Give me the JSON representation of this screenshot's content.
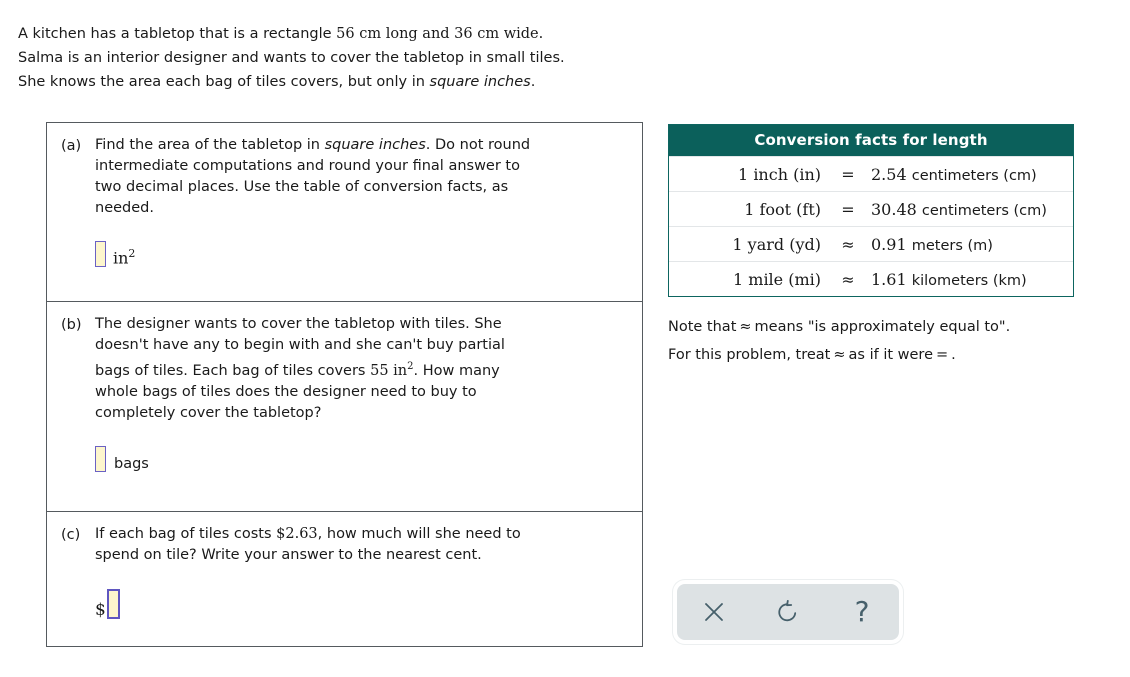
{
  "intro": {
    "line1_a": "A kitchen has a tabletop that is a rectangle ",
    "line1_num1": "56",
    "line1_b": " cm long and ",
    "line1_num2": "36",
    "line1_c": " cm wide.",
    "line2": "Salma is an interior designer and wants to cover the tabletop in small tiles.",
    "line3_a": "She knows the area each bag of tiles covers, but only in ",
    "line3_em": "square inches",
    "line3_b": "."
  },
  "parts": {
    "a": {
      "label": "(a)",
      "text_l1_a": "Find the area of the tabletop in ",
      "text_l1_em": "square inches",
      "text_l1_b": ". Do not round",
      "text_l2": "intermediate computations and round your final answer to",
      "text_l3": "two decimal places. Use the table of conversion facts, as",
      "text_l4": "needed.",
      "answer_value": "",
      "unit": "in",
      "unit_exponent": "2"
    },
    "b": {
      "label": "(b)",
      "text_l1": "The designer wants to cover the tabletop with tiles. She",
      "text_l2": "doesn't have any to begin with and she can't buy partial",
      "text_l3_a": "bags of tiles. Each bag of tiles covers ",
      "text_l3_num": "55",
      "text_l3_unit": "in",
      "text_l3_exp": "2",
      "text_l3_b": ". How many",
      "text_l4": "whole bags of tiles does the designer need to buy to",
      "text_l5": "completely cover the tabletop?",
      "answer_value": "",
      "unit": "bags"
    },
    "c": {
      "label": "(c)",
      "text_l1_a": "If each bag of tiles costs ",
      "text_l1_price": "$2.63",
      "text_l1_b": ", how much will she need to",
      "text_l2": "spend on tile? Write your answer to the nearest cent.",
      "currency_symbol": "$",
      "answer_value": ""
    }
  },
  "conversion_table": {
    "title": "Conversion facts for length",
    "rows": [
      {
        "left": "1 inch (in)",
        "rel": "=",
        "right_num": "2.54",
        "right_unit": "centimeters (cm)"
      },
      {
        "left": "1 foot (ft)",
        "rel": "=",
        "right_num": "30.48",
        "right_unit": "centimeters (cm)"
      },
      {
        "left": "1 yard (yd)",
        "rel": "≈",
        "right_num": "0.91",
        "right_unit": "meters (m)"
      },
      {
        "left": "1 mile (mi)",
        "rel": "≈",
        "right_num": "1.61",
        "right_unit": "kilometers (km)"
      }
    ]
  },
  "note": {
    "line1_a": "Note that",
    "line1_sym": "≈",
    "line1_b": "means \"is approximately equal to\".",
    "line2_a": "For this problem, treat",
    "line2_sym": "≈",
    "line2_b": "as if it were",
    "line2_sym2": "=",
    "line2_c": "."
  },
  "tools": {
    "clear_label": "×",
    "undo_label": "undo",
    "help_label": "?"
  },
  "colors": {
    "table_header_bg": "#0b605b",
    "table_border": "#0d6560",
    "input_fill": "#fdf6cd",
    "input_border": "#6a61c4",
    "panel_border": "#555a5e",
    "tool_panel_bg": "#dde2e4",
    "tool_icon": "#46606b"
  }
}
